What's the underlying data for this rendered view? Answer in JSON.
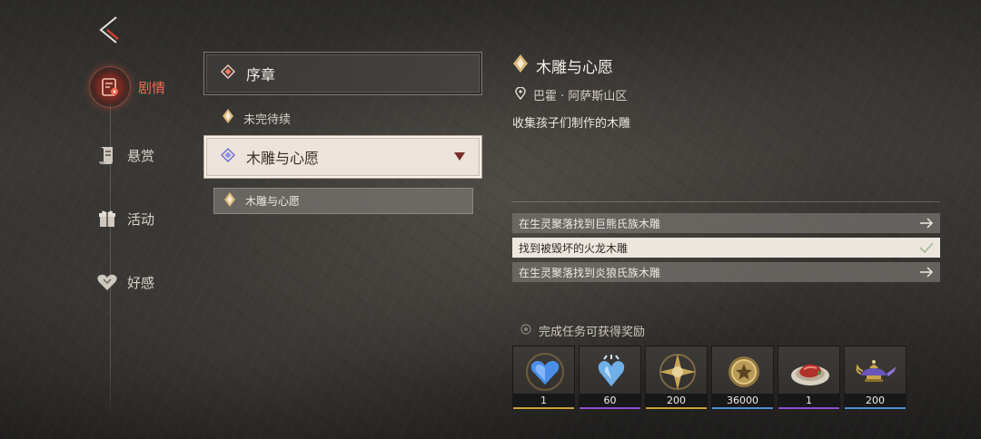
{
  "nav": {
    "items": [
      {
        "label": "剧情",
        "icon": "story-scroll-icon",
        "active": true
      },
      {
        "label": "悬赏",
        "icon": "bounty-scroll-icon",
        "active": false
      },
      {
        "label": "活动",
        "icon": "gift-box-icon",
        "active": false
      },
      {
        "label": "好感",
        "icon": "heart-icon",
        "active": false
      }
    ]
  },
  "list": {
    "chapter_prologue": "序章",
    "status_label": "未完待续",
    "chapter_selected": "木雕与心愿",
    "quest_entry": "木雕与心愿"
  },
  "detail": {
    "title": "木雕与心愿",
    "location": "巴霍 · 阿萨斯山区",
    "description": "收集孩子们制作的木雕",
    "objectives": [
      {
        "text": "在生灵聚落找到巨熊氏族木雕",
        "state": "open"
      },
      {
        "text": "找到被毁坏的火龙木雕",
        "state": "done"
      },
      {
        "text": "在生灵聚落找到炎狼氏族木雕",
        "state": "open"
      }
    ],
    "reward_title": "完成任务可获得奖励",
    "rewards": [
      {
        "count": "1",
        "icon": "blue-heart-gem-icon",
        "rarity_color": "#c9a23a"
      },
      {
        "count": "60",
        "icon": "crystal-heart-icon",
        "rarity_color": "#8e4fd0"
      },
      {
        "count": "200",
        "icon": "golden-star-emblem-icon",
        "rarity_color": "#c9a23a"
      },
      {
        "count": "36000",
        "icon": "gold-coin-icon",
        "rarity_color": "#4f8fd6"
      },
      {
        "count": "1",
        "icon": "meat-dish-icon",
        "rarity_color": "#8e4fd0"
      },
      {
        "count": "200",
        "icon": "magic-lamp-icon",
        "rarity_color": "#4f8fd6"
      }
    ]
  },
  "colors": {
    "accent": "#f06a52",
    "marker": "#d9b678"
  }
}
